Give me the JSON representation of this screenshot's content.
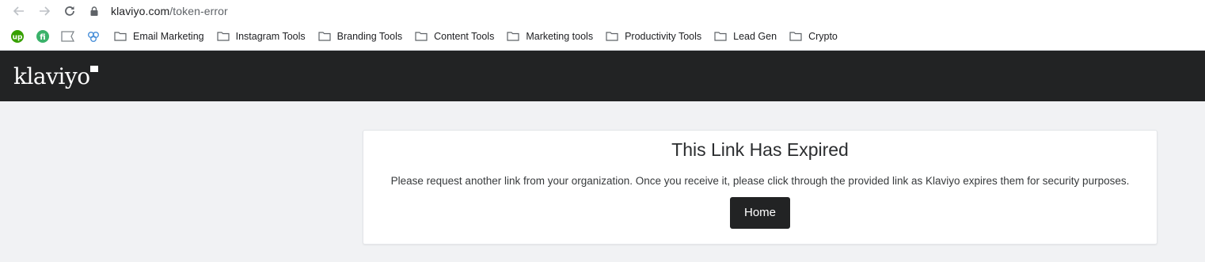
{
  "browser": {
    "url_domain": "klaviyo.com",
    "url_path": "/token-error",
    "nav": [
      "back-icon",
      "forward-icon",
      "reload-icon"
    ]
  },
  "bookmarks": {
    "extensions": [
      "upwork-icon",
      "fi-icon",
      "flag-icon",
      "chain-icon"
    ],
    "folders": [
      {
        "label": "Email Marketing"
      },
      {
        "label": "Instagram Tools"
      },
      {
        "label": "Branding Tools"
      },
      {
        "label": "Content Tools"
      },
      {
        "label": "Marketing tools"
      },
      {
        "label": "Productivity Tools"
      },
      {
        "label": "Lead Gen"
      },
      {
        "label": "Crypto"
      }
    ]
  },
  "header": {
    "logo_text": "klaviyo"
  },
  "card": {
    "title": "This Link Has Expired",
    "message": "Please request another link from your organization. Once you receive it, please click through the provided link as Klaviyo expires them for security purposes.",
    "home_label": "Home"
  },
  "colors": {
    "header_bg": "#222324",
    "page_bg": "#f1f2f4",
    "button_bg": "#222324"
  }
}
